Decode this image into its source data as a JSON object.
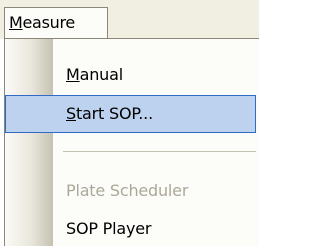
{
  "menubar": {
    "title_mnemonic": "M",
    "title_rest": "easure"
  },
  "menu": {
    "items": [
      {
        "mnemonic": "M",
        "rest": "anual",
        "state": "normal"
      },
      {
        "mnemonic": "S",
        "rest": "tart SOP...",
        "state": "highlighted"
      },
      {
        "label": "Plate Scheduler",
        "state": "disabled"
      },
      {
        "label": "SOP Player",
        "state": "normal"
      }
    ]
  },
  "colors": {
    "highlight_fill": "#bcd2ee",
    "highlight_border": "#3169c6",
    "disabled_text": "#aca899"
  }
}
